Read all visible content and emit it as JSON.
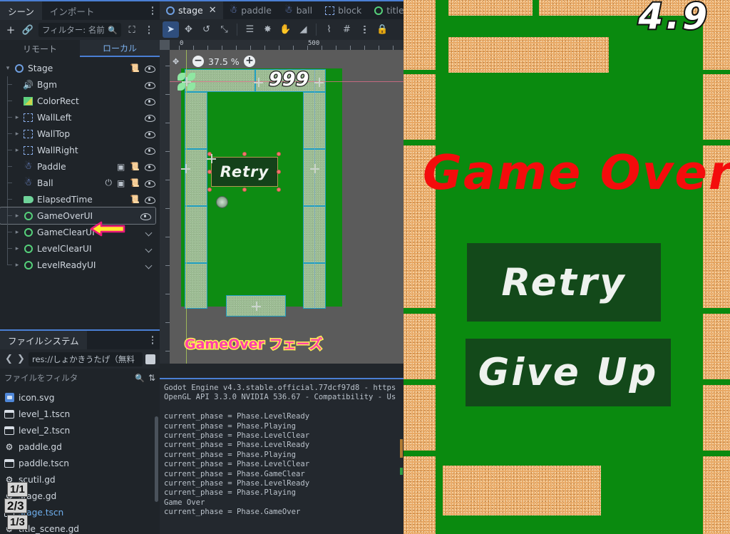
{
  "editor": {
    "scene_dock": {
      "tabs": [
        {
          "label": "シーン",
          "active": true
        },
        {
          "label": "インポート",
          "active": false
        }
      ],
      "toolbar": {
        "add_icon": "plus-icon",
        "link_icon": "link-icon",
        "filter_placeholder": "フィルター: 名前",
        "search_icon": "search-icon",
        "instance_icon": "instance-scene-icon",
        "menu_icon": "vertical-dots-icon"
      },
      "remote_local": [
        {
          "label": "リモート",
          "active": false
        },
        {
          "label": "ローカル",
          "active": true
        }
      ],
      "tree": [
        {
          "label": "Stage",
          "depth": 0,
          "icon": "node2d-circle-icon",
          "expander": "open",
          "script": true,
          "eye": true,
          "unique": false,
          "anim": false,
          "chev": false
        },
        {
          "label": "Bgm",
          "depth": 1,
          "icon": "audio-speaker-icon",
          "expander": "none",
          "script": false,
          "eye": true,
          "unique": false,
          "anim": false,
          "chev": false
        },
        {
          "label": "ColorRect",
          "depth": 1,
          "icon": "colorrect-icon",
          "expander": "none",
          "script": false,
          "eye": true,
          "unique": false,
          "anim": false,
          "chev": false
        },
        {
          "label": "WallLeft",
          "depth": 1,
          "icon": "dashed-box-icon",
          "expander": "closed",
          "script": false,
          "eye": true,
          "unique": false,
          "anim": false,
          "chev": false
        },
        {
          "label": "WallTop",
          "depth": 1,
          "icon": "dashed-box-icon",
          "expander": "closed",
          "script": false,
          "eye": true,
          "unique": false,
          "anim": false,
          "chev": false
        },
        {
          "label": "WallRight",
          "depth": 1,
          "icon": "dashed-box-icon",
          "expander": "closed",
          "script": false,
          "eye": true,
          "unique": false,
          "anim": false,
          "chev": false
        },
        {
          "label": "Paddle",
          "depth": 1,
          "icon": "character-body-icon",
          "expander": "none",
          "script": true,
          "eye": true,
          "unique": false,
          "anim": true,
          "chev": false
        },
        {
          "label": "Ball",
          "depth": 1,
          "icon": "character-body-icon",
          "expander": "none",
          "script": true,
          "eye": true,
          "unique": true,
          "anim": true,
          "chev": false
        },
        {
          "label": "ElapsedTime",
          "depth": 1,
          "icon": "label-icon",
          "expander": "none",
          "script": true,
          "eye": true,
          "unique": false,
          "anim": false,
          "chev": false
        },
        {
          "label": "GameOverUI",
          "depth": 1,
          "icon": "control-circle-icon",
          "expander": "closed",
          "script": false,
          "eye": true,
          "unique": false,
          "anim": false,
          "chev": false,
          "selected": true
        },
        {
          "label": "GameClearUI",
          "depth": 1,
          "icon": "control-circle-icon",
          "expander": "closed",
          "script": false,
          "eye": false,
          "unique": false,
          "anim": false,
          "chev": true
        },
        {
          "label": "LevelClearUI",
          "depth": 1,
          "icon": "control-circle-icon",
          "expander": "closed",
          "script": false,
          "eye": false,
          "unique": false,
          "anim": false,
          "chev": true
        },
        {
          "label": "LevelReadyUI",
          "depth": 1,
          "icon": "control-circle-icon",
          "expander": "closed",
          "script": false,
          "eye": false,
          "unique": false,
          "anim": false,
          "chev": true
        }
      ]
    },
    "filesystem_dock": {
      "tab_label": "ファイルシステム",
      "menu_icon": "vertical-dots-icon",
      "back_icon": "chevron-left-icon",
      "forward_icon": "chevron-right-icon",
      "path": "res://しょかきうたげ（無料",
      "filter_placeholder": "ファイルをフィルタ",
      "search_icon": "search-icon",
      "sort_icon": "sort-icon",
      "files": [
        {
          "name": "icon.svg",
          "icon": "svg-file-icon",
          "selected": false
        },
        {
          "name": "level_1.tscn",
          "icon": "scene-file-icon",
          "selected": false
        },
        {
          "name": "level_2.tscn",
          "icon": "scene-file-icon",
          "selected": false
        },
        {
          "name": "paddle.gd",
          "icon": "script-file-icon",
          "selected": false
        },
        {
          "name": "paddle.tscn",
          "icon": "scene-file-icon",
          "selected": false
        },
        {
          "name": "scutil.gd",
          "icon": "script-file-icon",
          "selected": false
        },
        {
          "name": "stage.gd",
          "icon": "script-file-icon",
          "selected": false
        },
        {
          "name": "stage.tscn",
          "icon": "scene-file-icon",
          "selected": true
        },
        {
          "name": "title_scene.gd",
          "icon": "script-file-icon",
          "selected": false
        }
      ]
    },
    "editor_tabs": [
      {
        "label": "stage",
        "icon": "node2d-circle-icon",
        "active": true,
        "closable": true
      },
      {
        "label": "paddle",
        "icon": "character-body-icon",
        "active": false,
        "closable": false
      },
      {
        "label": "ball",
        "icon": "character-body-icon",
        "active": false,
        "closable": false
      },
      {
        "label": "block",
        "icon": "dashed-box-icon",
        "active": false,
        "closable": false
      },
      {
        "label": "title_s",
        "icon": "control-circle-icon",
        "active": false,
        "closable": false
      }
    ],
    "viewport_toolbar": [
      {
        "name": "select-tool",
        "glyph": "➤",
        "active": true
      },
      {
        "name": "move-tool",
        "glyph": "✥",
        "active": false
      },
      {
        "name": "rotate-tool",
        "glyph": "↺",
        "active": false
      },
      {
        "name": "scale-tool",
        "glyph": "⤡",
        "active": false
      },
      {
        "name": "list-select-tool",
        "glyph": "☰",
        "active": false
      },
      {
        "name": "ruler-pivot-tool",
        "glyph": "✸",
        "active": false
      },
      {
        "name": "pan-tool",
        "glyph": "✋",
        "active": false
      },
      {
        "name": "ruler-tool",
        "glyph": "◢",
        "active": false
      },
      {
        "name": "snap-tool",
        "glyph": "⌇",
        "active": false
      },
      {
        "name": "grid-snap-tool",
        "glyph": "#",
        "active": false
      },
      {
        "name": "snap-options-menu",
        "glyph": "⋮",
        "active": false
      },
      {
        "name": "lock-tool",
        "glyph": "ὑ2",
        "active": false
      }
    ],
    "viewport": {
      "zoom_level": "37.5 %",
      "zoom_out_icon": "zoom-out-icon",
      "zoom_in_icon": "zoom-in-icon",
      "ruler_labels": [
        "0",
        "500"
      ],
      "score_display": "999",
      "retry_button_label": "Retry",
      "phase_overlay_label": "GameOver フェーズ"
    },
    "output_panel": {
      "lines": [
        "Godot Engine v4.3.stable.official.77dcf97d8 - https",
        "OpenGL API 3.3.0 NVIDIA 536.67 - Compatibility - Us",
        "",
        "current_phase = Phase.LevelReady",
        "current_phase = Phase.Playing",
        "current_phase = Phase.LevelClear",
        "current_phase = Phase.LevelReady",
        "current_phase = Phase.Playing",
        "current_phase = Phase.LevelClear",
        "current_phase = Phase.GameClear",
        "current_phase = Phase.LevelReady",
        "current_phase = Phase.Playing",
        "Game Over",
        "current_phase = Phase.GameOver"
      ]
    },
    "overlay_badges": [
      {
        "label": "1/1"
      },
      {
        "label": "2/3"
      },
      {
        "label": "1/3"
      }
    ],
    "annotation_arrow": "left-pointing-arrow-icon"
  },
  "game": {
    "timer": "4.9",
    "title": "Game Over",
    "buttons": [
      {
        "label": "Retry"
      },
      {
        "label": "Give Up"
      }
    ],
    "colors": {
      "field_green": "#0a8a0f",
      "block_orange": "#e8a864",
      "title_red": "#f40c0c",
      "button_dark_green": "#13491a",
      "button_text": "#eef2ee"
    }
  }
}
